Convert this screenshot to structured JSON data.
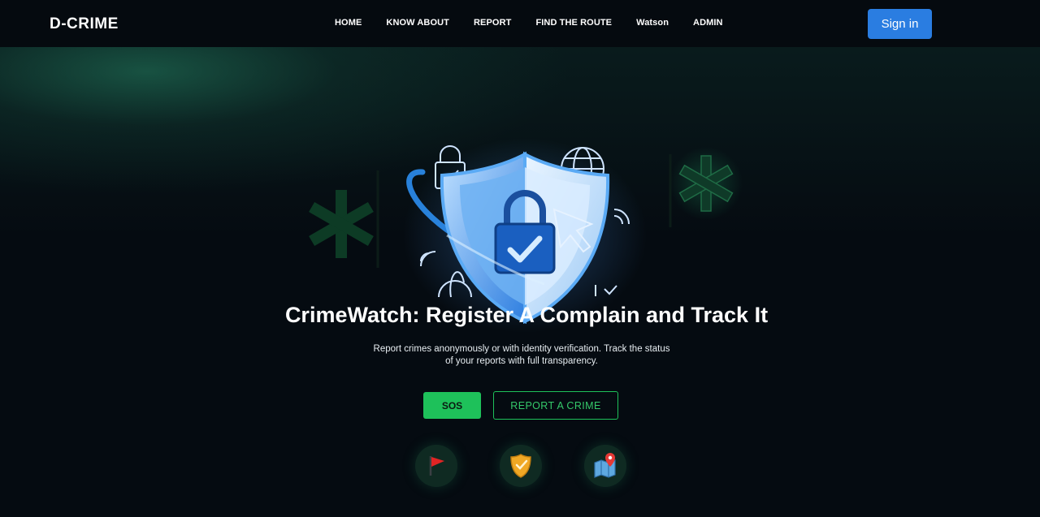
{
  "brand": "D-CRIME",
  "nav": {
    "items": [
      "HOME",
      "KNOW ABOUT",
      "REPORT",
      "FIND THE ROUTE",
      "Watson",
      "ADMIN"
    ],
    "signin_label": "Sign in"
  },
  "hero": {
    "title": "CrimeWatch: Register A Complain and Track It",
    "subtitle_line1": "Report crimes anonymously or with identity verification. Track the status",
    "subtitle_line2": "of your reports with full transparency.",
    "sos_label": "SOS",
    "report_label": "REPORT A CRIME"
  },
  "features": [
    {
      "icon": "red-flag-icon"
    },
    {
      "icon": "police-badge-icon"
    },
    {
      "icon": "map-pin-icon"
    }
  ],
  "colors": {
    "background": "#050b11",
    "accent_green": "#1ec15a",
    "signin_blue": "#2a7de1",
    "shield_blue": "#3b8fe6"
  }
}
